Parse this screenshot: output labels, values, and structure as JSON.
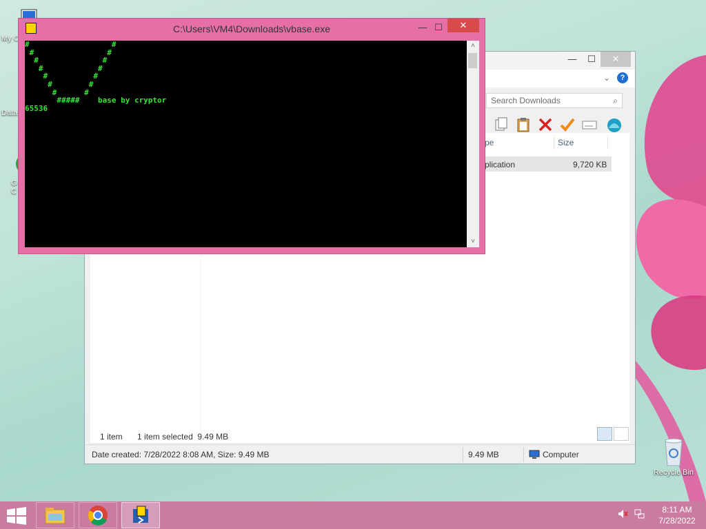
{
  "desktop": {
    "icons": [
      {
        "label": "My C"
      },
      {
        "label": "Data"
      },
      {
        "label": "G\nC"
      }
    ],
    "recycle_bin_label": "Recycle Bin"
  },
  "console": {
    "title": "C:\\Users\\VM4\\Downloads\\vbase.exe",
    "output_lines": [
      "#                  #",
      " #                #",
      "  #              #",
      "   #            #",
      "    #          #",
      "     #        #",
      "      #      #",
      "       #####    base by cryptor",
      "65536"
    ]
  },
  "explorer": {
    "search_placeholder": "Search Downloads",
    "columns": [
      {
        "label": "pe"
      },
      {
        "label": "Size"
      }
    ],
    "rows": [
      {
        "type": "plication",
        "size": "9,720 KB"
      }
    ],
    "status": {
      "items_count": "1 item",
      "selected": "1 item selected  9.49 MB"
    },
    "details_bar": {
      "info": "Date created: 7/28/2022 8:08 AM, Size: 9.49 MB",
      "size": "9.49 MB",
      "location": "Computer"
    }
  },
  "taskbar": {
    "apps": [
      {
        "name": "file-explorer"
      },
      {
        "name": "chrome"
      },
      {
        "name": "vbase-console"
      }
    ],
    "clock_time": "8:11 AM",
    "clock_date": "7/28/2022"
  },
  "colors": {
    "console_frame": "#e76fa8",
    "console_text": "#33e533",
    "taskbar": "#c97ca0"
  }
}
